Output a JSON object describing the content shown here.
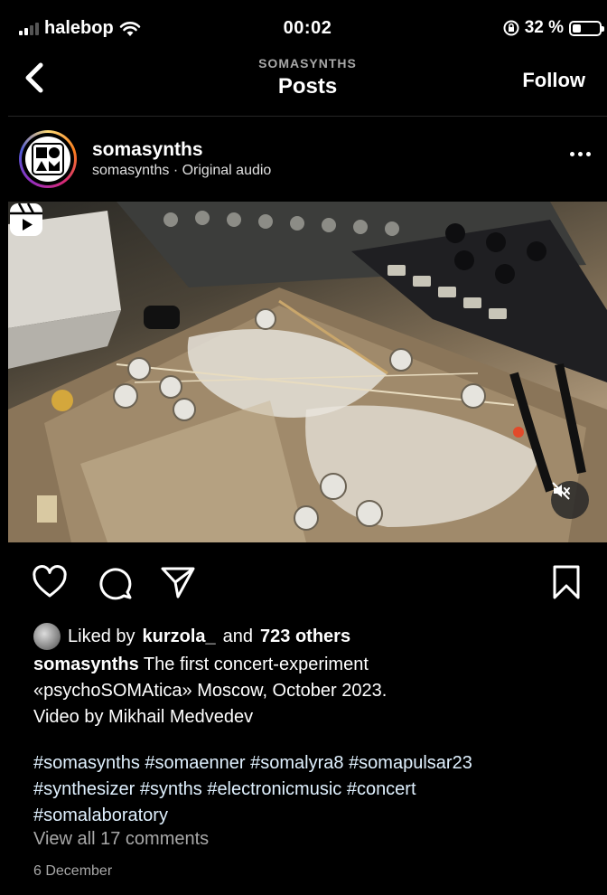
{
  "status_bar": {
    "carrier": "halebop",
    "time": "00:02",
    "battery_percent_label": "32 %",
    "battery_level": 0.32
  },
  "nav": {
    "back_icon": "chevron-left-icon",
    "subtitle": "SOMASYNTHS",
    "title": "Posts",
    "follow_label": "Follow"
  },
  "post": {
    "username": "somasynths",
    "subline": "somasynths · Original audio",
    "more_icon": "more-horizontal-icon",
    "media_icons": [
      "reels-icon",
      "muted-speaker-icon"
    ],
    "actions": [
      "heart-icon",
      "comment-icon",
      "share-icon",
      "bookmark-icon"
    ],
    "likes": {
      "prefix": "Liked by",
      "user": "kurzola_",
      "middle": "and",
      "others": "723 others"
    },
    "caption": {
      "author": "somasynths",
      "line1": "The first concert-experiment",
      "line2": "«psychoSOMAtica» Moscow, October 2023.",
      "line3": "Video by Mikhail Medvedev"
    },
    "hashtags": {
      "line1": "#somasynths #somaenner #somalyra8 #somapulsar23",
      "line2": "#synthesizer #synths #electronicmusic #concert",
      "line3": "#somalaboratory"
    },
    "view_comments": "View all 17 comments",
    "date": "6 December"
  },
  "colors": {
    "background": "#000000",
    "secondary_text": "#a8a8a8",
    "divider": "#262626"
  }
}
